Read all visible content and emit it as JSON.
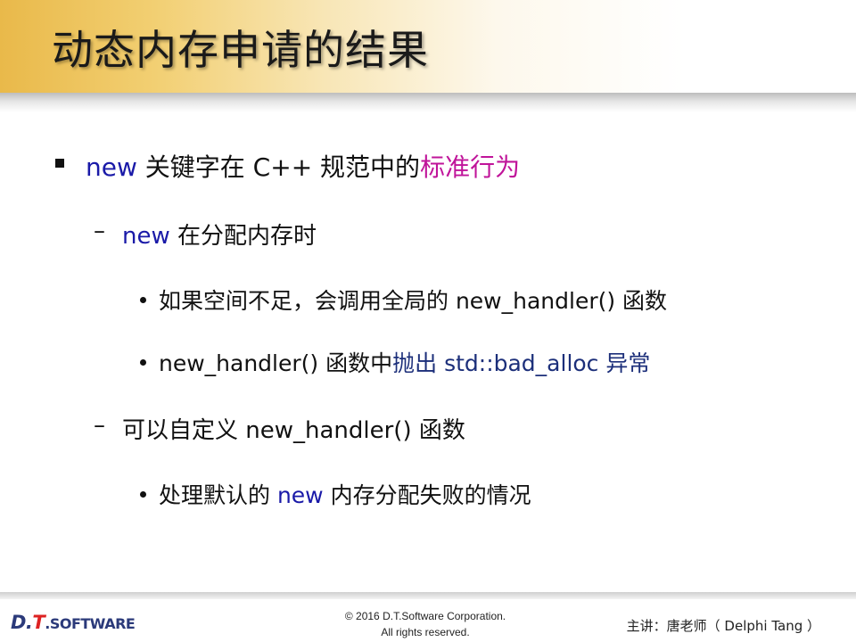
{
  "title": "动态内存申请的结果",
  "bullet1": {
    "kw": "new",
    "text": " 关键字在 C++ 规范中的",
    "highlight": "标准行为"
  },
  "sub1": {
    "kw": "new",
    "text": " 在分配内存时"
  },
  "sub1_item1": "如果空间不足，会调用全局的 new_handler()  函数",
  "sub1_item2": {
    "text": "new_handler() 函数中",
    "highlight": "抛出 std::bad_alloc 异常"
  },
  "sub2": "可以自定义 new_handler()  函数",
  "sub2_item1": {
    "text": "处理默认的 ",
    "kw": "new",
    "rest": " 内存分配失败的情况"
  },
  "dash": "–",
  "footer": {
    "logo_d": "D.",
    "logo_t": "T",
    "logo_soft": ".SOFTWARE",
    "copyright1": "© 2016 D.T.Software Corporation.",
    "copyright2": "All rights reserved.",
    "author": "主讲：唐老师（ Delphi Tang ）"
  },
  "colors": {
    "keyword": "#1a1aa8",
    "highlight": "#c0149a",
    "navy": "#1c2f7a"
  }
}
